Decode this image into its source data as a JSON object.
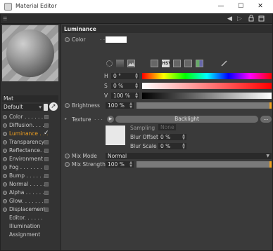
{
  "window": {
    "title": "Material Editor",
    "minimize": "—",
    "maximize": "☐",
    "close": "✕"
  },
  "toolbar": {
    "back": "◀",
    "forward": "▷",
    "lock": "🔒",
    "more": "☐"
  },
  "material": {
    "name": "Mat",
    "layout": "Default"
  },
  "channels": [
    {
      "label": "Color . . . . . .",
      "checkbox": true,
      "active": false
    },
    {
      "label": "Diffusion. . . .",
      "checkbox": true,
      "active": false
    },
    {
      "label": "Luminance . . .",
      "checkbox": true,
      "active": true,
      "checked": true
    },
    {
      "label": "Transparency",
      "checkbox": true,
      "active": false
    },
    {
      "label": "Reflectance. . .",
      "checkbox": true,
      "active": false
    },
    {
      "label": "Environment",
      "checkbox": true,
      "active": false
    },
    {
      "label": "Fog . . . . . . .",
      "checkbox": true,
      "active": false
    },
    {
      "label": "Bump . . . . . .",
      "checkbox": true,
      "active": false
    },
    {
      "label": "Normal . . . . .",
      "checkbox": true,
      "active": false
    },
    {
      "label": "Alpha . . . . . .",
      "checkbox": true,
      "active": false
    },
    {
      "label": "Glow. . . . . . .",
      "checkbox": true,
      "active": false
    },
    {
      "label": "Displacement",
      "checkbox": true,
      "active": false
    },
    {
      "label": "Editor. . . . . .",
      "checkbox": false,
      "active": false
    },
    {
      "label": "Illumination",
      "checkbox": false,
      "active": false
    },
    {
      "label": "Assignment",
      "checkbox": false,
      "active": false
    }
  ],
  "section": {
    "title": "Luminance"
  },
  "color": {
    "label": "Color",
    "value": "#ffffff"
  },
  "hsv": {
    "h_label": "H",
    "h_value": "0 °",
    "s_label": "S",
    "s_value": "0 %",
    "v_label": "V",
    "v_value": "100 %"
  },
  "brightness": {
    "label": "Brightness",
    "value": "100 %",
    "level": 1.0
  },
  "texture": {
    "label": "Texture",
    "arrow": "▶",
    "file": "Backlight",
    "more": "...",
    "sampling_label": "Sampling",
    "sampling_value": "None",
    "blur_offset_label": "Blur Offset",
    "blur_offset_value": "0 %",
    "blur_scale_label": "Blur Scale",
    "blur_scale_value": "0 %"
  },
  "mix": {
    "mode_label": "Mix Mode",
    "mode_value": "Normal",
    "strength_label": "Mix Strength",
    "strength_value": "100 %",
    "strength_level": 1.0
  },
  "colors": {
    "accent": "#f0a020",
    "panel": "#3a3a3a",
    "field": "#2a2a2a"
  }
}
